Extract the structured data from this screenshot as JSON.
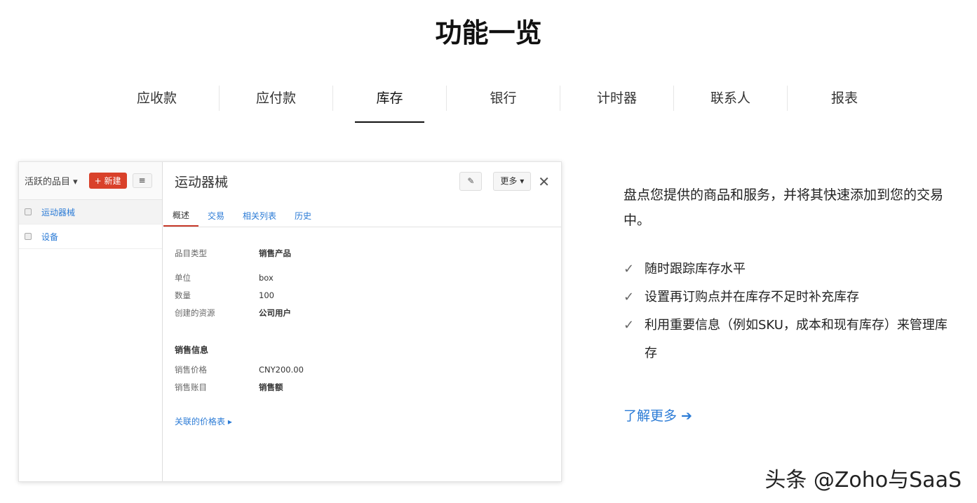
{
  "title": "功能一览",
  "tabs": [
    "应收款",
    "应付款",
    "库存",
    "银行",
    "计时器",
    "联系人",
    "报表"
  ],
  "active_tab": "库存",
  "app": {
    "sidebar": {
      "title": "活跃的品目 ▾",
      "new_button": "+ 新建",
      "menu_icon": "menu-icon",
      "items": [
        "运动器械",
        "设备"
      ]
    },
    "detail": {
      "title": "运动器械",
      "more_button": "更多 ▾",
      "tabs": [
        "概述",
        "交易",
        "相关列表",
        "历史"
      ],
      "fields": [
        {
          "k": "品目类型",
          "v": "销售产品"
        },
        {
          "k": "单位",
          "v": "box"
        },
        {
          "k": "数量",
          "v": "100"
        },
        {
          "k": "创建的资源",
          "v": "公司用户"
        }
      ],
      "sales_section": "销售信息",
      "sales_fields": [
        {
          "k": "销售价格",
          "v": "CNY200.00"
        },
        {
          "k": "销售账目",
          "v": "销售额"
        }
      ],
      "price_list_link": "关联的价格表 ▸"
    }
  },
  "description": "盘点您提供的商品和服务，并将其快速添加到您的交易中。",
  "features": [
    "随时跟踪库存水平",
    "设置再订购点并在库存不足时补充库存",
    "利用重要信息（例如SKU，成本和现有库存）来管理库存"
  ],
  "learn_more": "了解更多 ➔",
  "watermark": "头条 @Zoho与SaaS",
  "colors": {
    "accent": "#2b7bd6",
    "new_button": "#d9412a"
  }
}
